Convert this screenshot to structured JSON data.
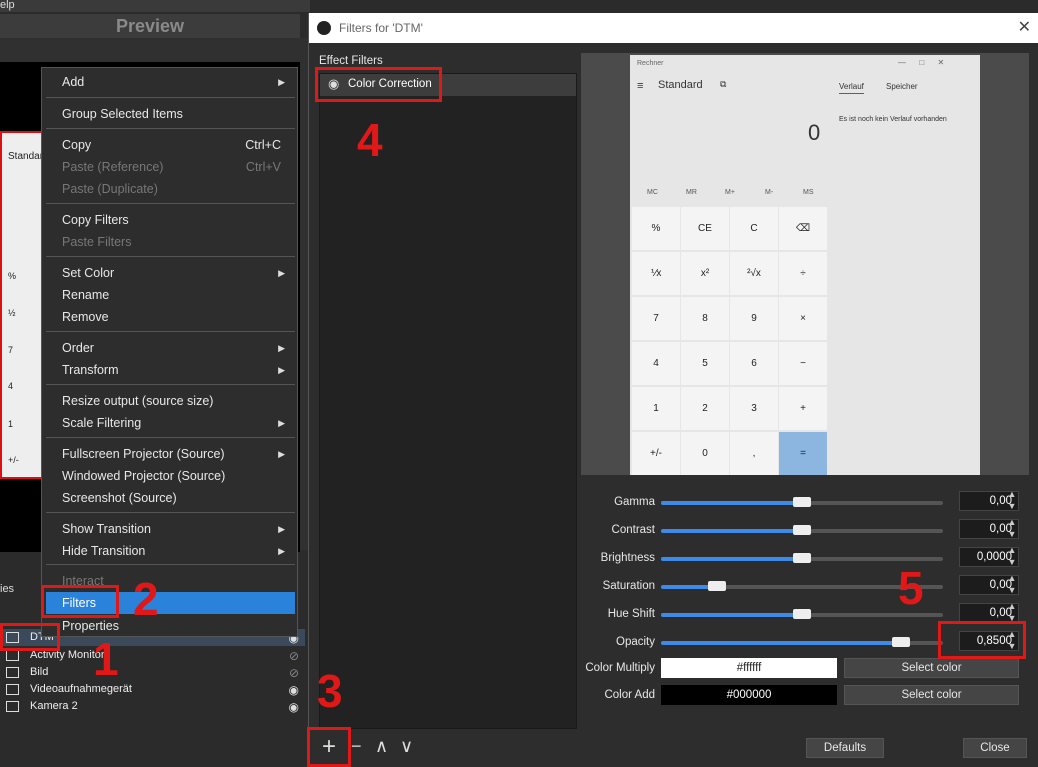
{
  "window": {
    "preview_title": "Preview",
    "menubar_fragment": "elp"
  },
  "context_menu": {
    "items": [
      {
        "label": "Add",
        "arrow": true
      },
      {
        "label": "Group Selected Items"
      },
      {
        "label": "Copy",
        "shortcut": "Ctrl+C"
      },
      {
        "label": "Paste (Reference)",
        "shortcut": "Ctrl+V",
        "disabled": true
      },
      {
        "label": "Paste (Duplicate)",
        "disabled": true
      },
      {
        "label": "Copy Filters"
      },
      {
        "label": "Paste Filters",
        "disabled": true
      },
      {
        "label": "Set Color",
        "arrow": true
      },
      {
        "label": "Rename"
      },
      {
        "label": "Remove"
      },
      {
        "label": "Order",
        "arrow": true
      },
      {
        "label": "Transform",
        "arrow": true
      },
      {
        "label": "Resize output (source size)"
      },
      {
        "label": "Scale Filtering",
        "arrow": true
      },
      {
        "label": "Fullscreen Projector (Source)",
        "arrow": true
      },
      {
        "label": "Windowed Projector (Source)"
      },
      {
        "label": "Screenshot (Source)"
      },
      {
        "label": "Show Transition",
        "arrow": true
      },
      {
        "label": "Hide Transition",
        "arrow": true
      },
      {
        "label": "Interact",
        "disabled": true
      },
      {
        "label": "Filters",
        "selected": true
      },
      {
        "label": "Properties"
      }
    ],
    "arrow_glyph": "▶"
  },
  "sources": {
    "header_fragment": "ies",
    "items": [
      "DTM",
      "Activity Monitor",
      "Bild",
      "Videoaufnahmegerät",
      "Kamera 2"
    ]
  },
  "mini_preview": {
    "labels": [
      "Standar",
      "%",
      "½",
      "7",
      "4",
      "1",
      "+/-"
    ]
  },
  "dialog": {
    "title": "Filters for 'DTM'",
    "close_glyph": "✕",
    "effect_filters_label": "Effect Filters",
    "filter_item": "Color Correction",
    "buttons": {
      "defaults": "Defaults",
      "close": "Close"
    },
    "toolbar": {
      "add": "+",
      "remove": "−",
      "up": "∧",
      "down": "∨"
    }
  },
  "calculator": {
    "title": "Rechner",
    "mode": "Standard",
    "display": "0",
    "tab_history": "Verlauf",
    "tab_memory": "Speicher",
    "history_text": "Es ist noch kein Verlauf vorhanden",
    "memory": [
      "MC",
      "MR",
      "M+",
      "M-",
      "MS"
    ],
    "keys": [
      "%",
      "CE",
      "C",
      "⌫",
      "⅟x",
      "x²",
      "²√x",
      "÷",
      "7",
      "8",
      "9",
      "×",
      "4",
      "5",
      "6",
      "−",
      "1",
      "2",
      "3",
      "+",
      "+/-",
      "0",
      ",",
      "="
    ]
  },
  "properties": [
    {
      "label": "Gamma",
      "value": "0,00",
      "fraction": 0.5
    },
    {
      "label": "Contrast",
      "value": "0,00",
      "fraction": 0.5
    },
    {
      "label": "Brightness",
      "value": "0,0000",
      "fraction": 0.5
    },
    {
      "label": "Saturation",
      "value": "0,00",
      "fraction": 0.2
    },
    {
      "label": "Hue Shift",
      "value": "0,00",
      "fraction": 0.5
    },
    {
      "label": "Opacity",
      "value": "0,8500",
      "fraction": 0.85
    }
  ],
  "colors": {
    "multiply_label": "Color Multiply",
    "multiply_value": "#ffffff",
    "add_label": "Color Add",
    "add_value": "#000000",
    "select_label": "Select color",
    "accent": "#2a82da",
    "annotation": "#e01818"
  },
  "annotations": [
    "1",
    "2",
    "3",
    "4",
    "5"
  ]
}
